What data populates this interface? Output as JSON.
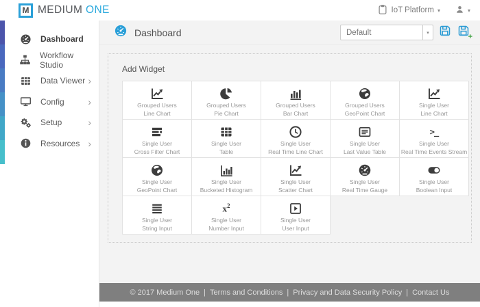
{
  "topbar": {
    "logo_letter": "M",
    "brand_primary": "MEDIUM",
    "brand_secondary": "ONE",
    "platform_label": "IoT Platform",
    "caret_glyph": "▾"
  },
  "sidebar": {
    "chevron_glyph": "›",
    "items": [
      {
        "label": "Dashboard",
        "icon": "dashboard-gauge",
        "active": true,
        "has_submenu": false
      },
      {
        "label": "Workflow Studio",
        "icon": "sitemap",
        "active": false,
        "has_submenu": false
      },
      {
        "label": "Data Viewer",
        "icon": "table",
        "active": false,
        "has_submenu": true
      },
      {
        "label": "Config",
        "icon": "monitor",
        "active": false,
        "has_submenu": true
      },
      {
        "label": "Setup",
        "icon": "gears",
        "active": false,
        "has_submenu": true
      },
      {
        "label": "Resources",
        "icon": "info-circle",
        "active": false,
        "has_submenu": true
      }
    ]
  },
  "main": {
    "title": "Dashboard",
    "dashboard_select_value": "Default",
    "add_widget_label": "Add Widget",
    "widgets": [
      {
        "line1": "Grouped Users",
        "line2": "Line Chart",
        "icon": "line-chart"
      },
      {
        "line1": "Grouped Users",
        "line2": "Pie Chart",
        "icon": "pie-chart"
      },
      {
        "line1": "Grouped Users",
        "line2": "Bar Chart",
        "icon": "bar-chart"
      },
      {
        "line1": "Grouped Users",
        "line2": "GeoPoint Chart",
        "icon": "globe"
      },
      {
        "line1": "Single User",
        "line2": "Line Chart",
        "icon": "line-chart"
      },
      {
        "line1": "Single User",
        "line2": "Cross Filter Chart",
        "icon": "cross-filter"
      },
      {
        "line1": "Single User",
        "line2": "Table",
        "icon": "table"
      },
      {
        "line1": "Single User",
        "line2": "Real Time Line Chart",
        "icon": "clock"
      },
      {
        "line1": "Single User",
        "line2": "Last Value Table",
        "icon": "list-table"
      },
      {
        "line1": "Single User",
        "line2": "Real Time Events Stream",
        "icon": "terminal"
      },
      {
        "line1": "Single User",
        "line2": "GeoPoint Chart",
        "icon": "globe"
      },
      {
        "line1": "Single User",
        "line2": "Bucketed Histogram",
        "icon": "histogram"
      },
      {
        "line1": "Single User",
        "line2": "Scatter Chart",
        "icon": "scatter"
      },
      {
        "line1": "Single User",
        "line2": "Real Time Gauge",
        "icon": "gauge"
      },
      {
        "line1": "Single User",
        "line2": "Boolean Input",
        "icon": "toggle"
      },
      {
        "line1": "Single User",
        "line2": "String Input",
        "icon": "lines"
      },
      {
        "line1": "Single User",
        "line2": "Number Input",
        "icon": "x-squared"
      },
      {
        "line1": "Single User",
        "line2": "User Input",
        "icon": "play-square"
      }
    ]
  },
  "footer": {
    "copyright": "© 2017 Medium One",
    "separator": "|",
    "links": [
      "Terms and Conditions",
      "Privacy and Data Security Policy",
      "Contact Us"
    ]
  },
  "colors": {
    "accent_blue": "#2aa0d8",
    "icon_dark": "#3d3d3d",
    "save_plus_green": "#3fa142",
    "footer_gray": "#7f7f7f",
    "content_bg": "#f3f3f3"
  }
}
